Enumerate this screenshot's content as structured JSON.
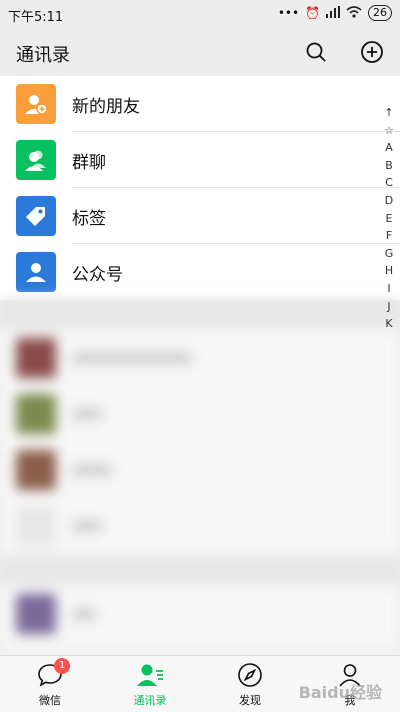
{
  "status": {
    "time": "下午5:11",
    "battery": "26"
  },
  "header": {
    "title": "通讯录"
  },
  "entries": [
    {
      "label": "新的朋友",
      "color": "#fa9d3b"
    },
    {
      "label": "群聊",
      "color": "#07c160"
    },
    {
      "label": "标签",
      "color": "#2b7ad9"
    },
    {
      "label": "公众号",
      "color": "#2b7ad9"
    }
  ],
  "index_letters": [
    "↑",
    "☆",
    "A",
    "B",
    "C",
    "D",
    "E",
    "F",
    "G",
    "H",
    "I",
    "J",
    "K"
  ],
  "tabs": [
    {
      "label": "微信",
      "badge": "1"
    },
    {
      "label": "通讯录"
    },
    {
      "label": "发现"
    },
    {
      "label": "我"
    }
  ],
  "colors": {
    "accent": "#07c160",
    "badge": "#fa5151"
  },
  "watermark": "Baidu经验"
}
